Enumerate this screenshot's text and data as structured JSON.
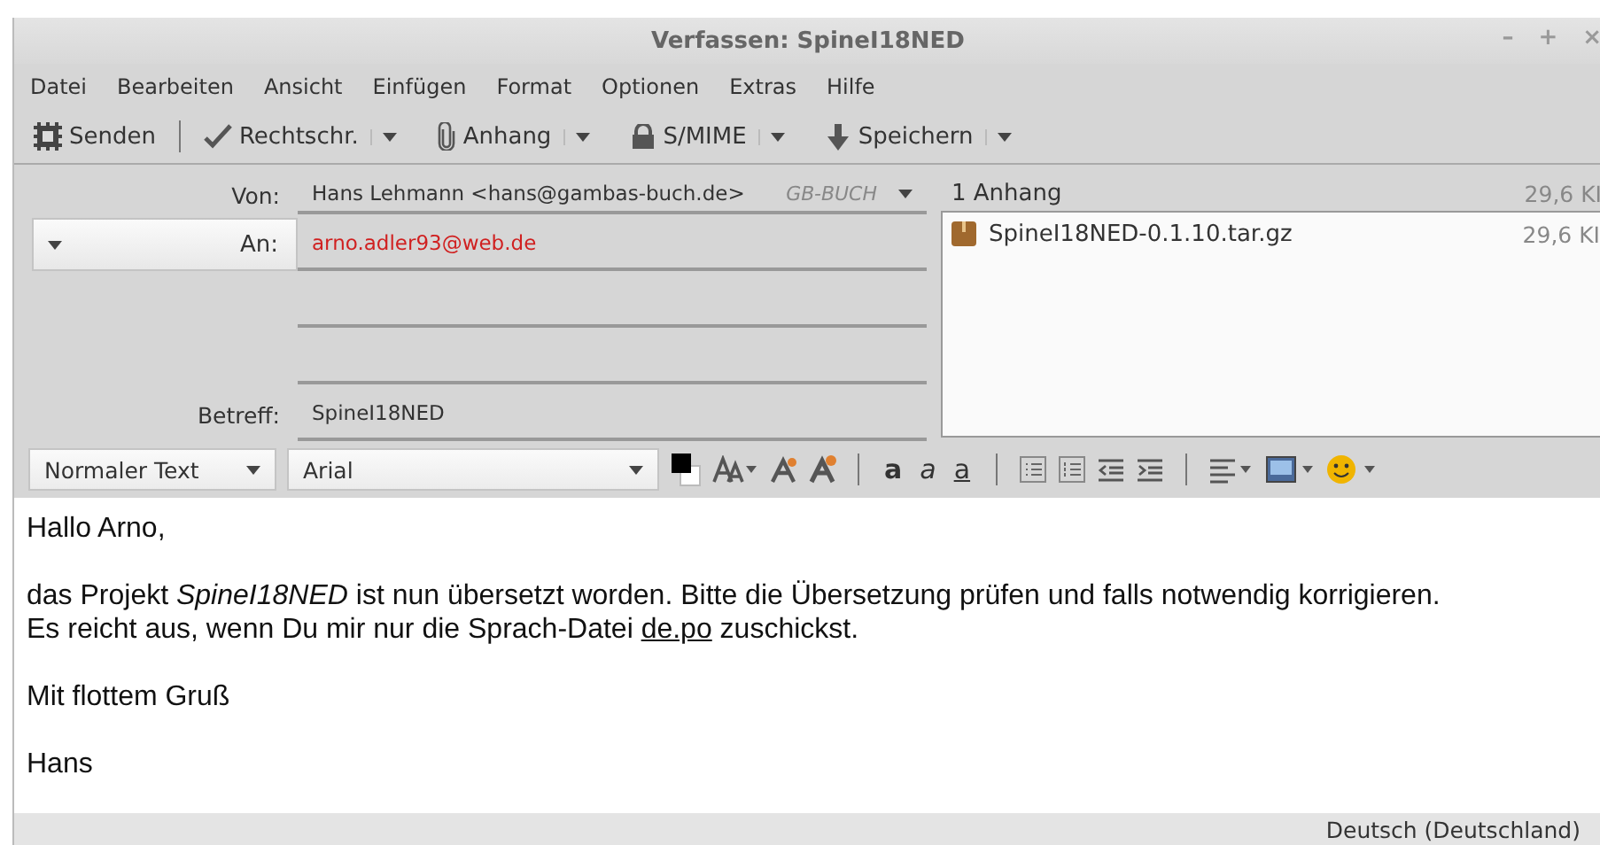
{
  "window": {
    "title": "Verfassen: SpineI18NED",
    "controls": [
      "–",
      "+",
      "×"
    ]
  },
  "menu": [
    "Datei",
    "Bearbeiten",
    "Ansicht",
    "Einfügen",
    "Format",
    "Optionen",
    "Extras",
    "Hilfe"
  ],
  "toolbar": [
    {
      "kind": "send",
      "label": "Senden"
    },
    {
      "kind": "spell",
      "label": "Rechtschr."
    },
    {
      "kind": "attach",
      "label": "Anhang"
    },
    {
      "kind": "lock",
      "label": "S/MIME"
    },
    {
      "kind": "save",
      "label": "Speichern"
    }
  ],
  "header": {
    "from_label": "Von:",
    "from_value": "Hans Lehmann <hans@gambas-buch.de>",
    "from_identity": "GB-BUCH",
    "to_label": "An:",
    "to_value": "arno.adler93@web.de",
    "subject_label": "Betreff:",
    "subject_value": "SpineI18NED"
  },
  "attachments": {
    "title": "1 Anhang",
    "total_size": "29,6 KI",
    "items": [
      {
        "name": "SpineI18NED-0.1.10.tar.gz",
        "size": "29,6 KI"
      }
    ]
  },
  "format_bar": {
    "paragraph": "Normaler Text",
    "font": "Arial",
    "text_style_buttons": [
      "a",
      "a",
      "a"
    ]
  },
  "body": [
    {
      "kind": "text",
      "text": "Hallo Arno,"
    },
    {
      "kind": "link_paragraph",
      "text": "das Projekt *SpineI18NED* ist nun übersetzt worden. Bitte die Übersetzung prüfen und falls notwendig korrigieren. Es reicht aus, wenn Du mir nur die Sprach-Datei ",
      "link": "de.po",
      "after": " zuschickst."
    },
    {
      "kind": "text",
      "text": "Mit flottem Gruß"
    },
    {
      "kind": "text",
      "text": "Hans"
    }
  ],
  "status_bar": {
    "language": "Deutsch (Deutschland)"
  }
}
